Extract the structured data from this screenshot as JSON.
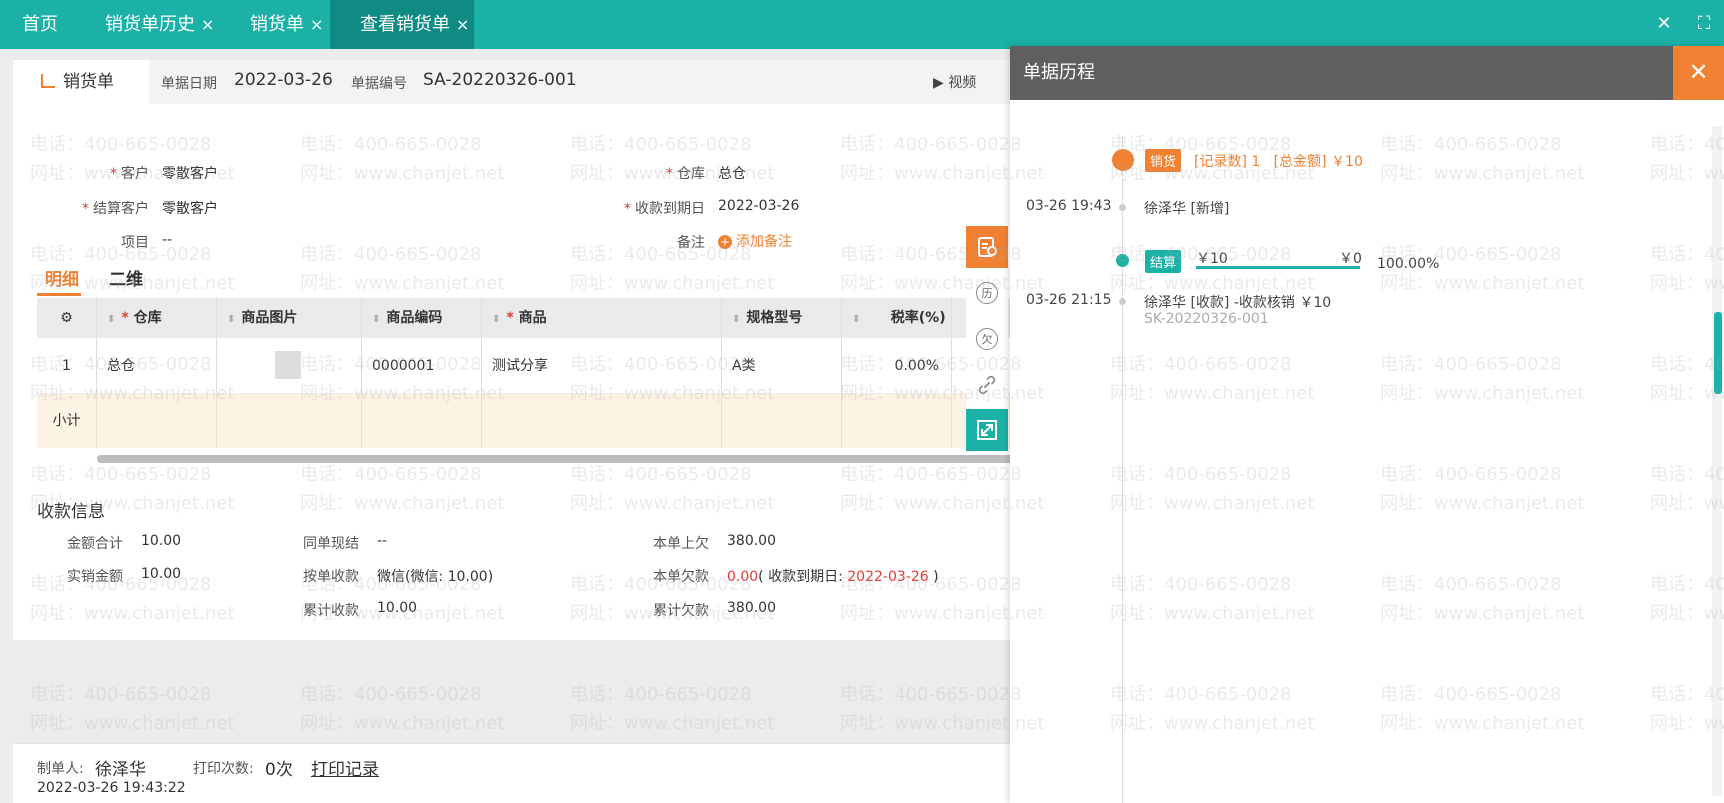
{
  "tabs": [
    {
      "label": "首页",
      "closable": false
    },
    {
      "label": "销货单历史",
      "closable": true
    },
    {
      "label": "销货单",
      "closable": true
    },
    {
      "label": "查看销货单",
      "closable": true,
      "active": true
    }
  ],
  "close_glyph": "×",
  "window": {
    "close": "✕",
    "fullscreen": "⛶"
  },
  "form": {
    "tab_label": "销货单",
    "date_label": "单据日期",
    "date_value": "2022-03-26",
    "no_label": "单据编号",
    "no_value": "SA-20220326-001",
    "video_label": "视频",
    "fields": {
      "customer_label": "客户",
      "customer_value": "零散客户",
      "settle_label": "结算客户",
      "settle_value": "零散客户",
      "project_label": "项目",
      "project_value": "--",
      "warehouse_label": "仓库",
      "warehouse_value": "总仓",
      "due_label": "收款到期日",
      "due_value": "2022-03-26",
      "note_label": "备注",
      "note_add": "添加备注",
      "required_mark": "*"
    },
    "subtabs": [
      "明细",
      "二维"
    ],
    "table": {
      "headers": [
        "仓库",
        "商品图片",
        "商品编码",
        "商品",
        "规格型号",
        "税率(%)"
      ],
      "rows": [
        {
          "index": "1",
          "warehouse": "总仓",
          "code": "0000001",
          "product": "测试分享",
          "spec": "A类",
          "tax": "0.00%"
        }
      ],
      "subtotal_label": "小计"
    },
    "payment": {
      "title": "收款信息",
      "amount_total_label": "金额合计",
      "amount_total": "10.00",
      "writeoff_label": "实销金额",
      "writeoff": "10.00",
      "same_cash_label": "同单现结",
      "same_cash": "--",
      "by_order_label": "按单收款",
      "by_order": "微信(微信: 10.00)",
      "cum_received_label": "累计收款",
      "cum_received": "10.00",
      "prev_owed_label": "本单上欠",
      "prev_owed": "380.00",
      "owed_label": "本单欠款",
      "owed": "0.00",
      "owed_due_prefix": "( 收款到期日: ",
      "owed_due": "2022-03-26",
      "owed_due_suffix": " )",
      "cum_owed_label": "累计欠款",
      "cum_owed": "380.00"
    },
    "footer": {
      "maker_label": "制单人:",
      "maker": "徐泽华",
      "print_count_label": "打印次数:",
      "print_count": "0次",
      "print_record": "打印记录",
      "created": "2022-03-26 19:43:22"
    }
  },
  "history": {
    "title": "单据历程",
    "close": "✕",
    "events": [
      {
        "badge": "销货",
        "summary_records_label": "[记录数]",
        "summary_records": "1",
        "summary_total_label": "[总金额]",
        "summary_total": "￥10"
      },
      {
        "time": "03-26 19:43",
        "text": "徐泽华 [新增]"
      },
      {
        "badge": "结算",
        "amount": "￥10",
        "remain": "￥0",
        "percent": "100.00%"
      },
      {
        "time": "03-26 21:15",
        "text": "徐泽华 [收款] -收款核销 ￥10",
        "ref": "SK-20220326-001"
      }
    ]
  },
  "watermark": {
    "phone": "电话：400-665-0028",
    "site": "网址：www.chanjet.net"
  },
  "colors": {
    "teal": "#1bb1a7",
    "orange": "#f08133",
    "red": "#e53935"
  }
}
